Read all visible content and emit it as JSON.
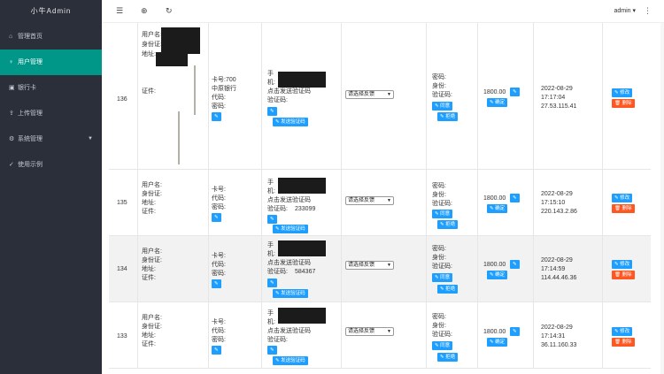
{
  "app": {
    "title": "小牛Admin",
    "user": "admin ▾"
  },
  "nav": [
    {
      "icon": "⌂",
      "label": "管理首页"
    },
    {
      "icon": "♀",
      "label": "用户管理"
    },
    {
      "icon": "▣",
      "label": "银行卡"
    },
    {
      "icon": "⇪",
      "label": "上传管理"
    },
    {
      "icon": "⚙",
      "label": "系统管理",
      "caret": "▼"
    },
    {
      "icon": "✓",
      "label": "使用示例"
    }
  ],
  "labels": {
    "username": "用户名:",
    "idcard": "身份证:",
    "address": "地址:",
    "cert": "证件:",
    "card_no": "卡号:",
    "code": "代码:",
    "pwd": "密码:",
    "phone_a": "手",
    "phone_b": "机:",
    "send_code": "点击发送验证码",
    "verify_code": "验证码:",
    "select_placeholder": "请选择反馈",
    "ver_pwd": "密码:",
    "ver_id": "身份:",
    "ver_code": "验证码:",
    "btn_send_verify": "✎ 发送验证码",
    "btn_edit": "✎",
    "btn_pass": "✎ 同意",
    "btn_reject": "✎ 拒绝",
    "btn_modify": "✎ 修改",
    "btn_delete": "🗑 删除",
    "btn_confirm": "✎ 确定"
  },
  "rows": [
    {
      "id": "136",
      "card_extra": "卡号:700",
      "card_extra2": "中原银行",
      "verify_code_value": "",
      "amount": "1800.00",
      "date": "2022-08-29",
      "time": "17:17:04",
      "ip": "27.53.115.41",
      "gray": false
    },
    {
      "id": "135",
      "card_extra": "",
      "card_extra2": "",
      "verify_code_value": "233099",
      "amount": "1800.00",
      "date": "2022-08-29",
      "time": "17:15:10",
      "ip": "220.143.2.86",
      "gray": false
    },
    {
      "id": "134",
      "card_extra": "",
      "card_extra2": "",
      "verify_code_value": "584367",
      "amount": "1800.00",
      "date": "2022-08-29",
      "time": "17:14:59",
      "ip": "114.44.46.36",
      "gray": true
    },
    {
      "id": "133",
      "card_extra": "",
      "card_extra2": "",
      "verify_code_value": "",
      "amount": "1800.00",
      "date": "2022-08-29",
      "time": "17:14:31",
      "ip": "36.11.160.33",
      "gray": false
    }
  ]
}
